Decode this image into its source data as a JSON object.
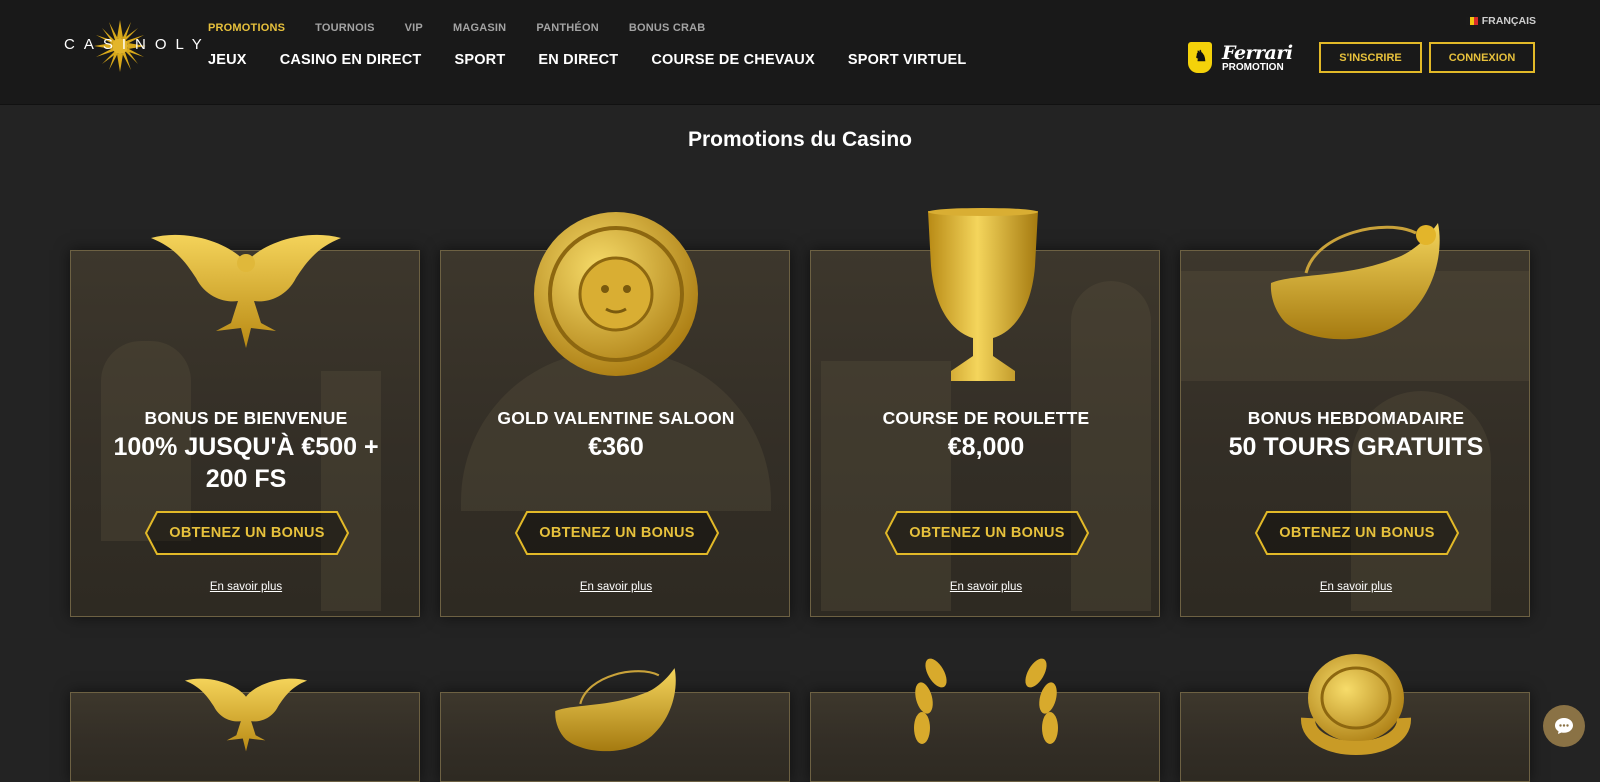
{
  "header": {
    "logo_text": "CASINOLY",
    "top_links": [
      {
        "label": "PROMOTIONS",
        "active": true
      },
      {
        "label": "TOURNOIS",
        "active": false
      },
      {
        "label": "VIP",
        "active": false
      },
      {
        "label": "MAGASIN",
        "active": false
      },
      {
        "label": "PANTHÉON",
        "active": false
      },
      {
        "label": "BONUS CRAB",
        "active": false
      }
    ],
    "main_links": [
      "JEUX",
      "CASINO EN DIRECT",
      "SPORT",
      "EN DIRECT",
      "COURSE DE CHEVAUX",
      "SPORT VIRTUEL"
    ],
    "language": "FRANÇAIS",
    "ferrari_word": "Ferrari",
    "ferrari_promo": "PROMOTION",
    "signup_label": "S'INSCRIRE",
    "login_label": "CONNEXION"
  },
  "page": {
    "title": "Promotions du Casino"
  },
  "promotions": [
    {
      "subtitle": "BONUS DE BIENVENUE",
      "headline": "100% JUSQU'À €500 + 200 FS",
      "button": "OBTENEZ UN BONUS",
      "link": "En savoir plus",
      "art_icon": "gold-eagle-icon"
    },
    {
      "subtitle": "GOLD VALENTINE SALOON",
      "headline": "€360",
      "button": "OBTENEZ UN BONUS",
      "link": "En savoir plus",
      "art_icon": "gold-medusa-shield-icon"
    },
    {
      "subtitle": "COURSE DE ROULETTE",
      "headline": "€8,000",
      "button": "OBTENEZ UN BONUS",
      "link": "En savoir plus",
      "art_icon": "gold-chalice-icon"
    },
    {
      "subtitle": "BONUS HEBDOMADAIRE",
      "headline": "50 TOURS GRATUITS",
      "button": "OBTENEZ UN BONUS",
      "link": "En savoir plus",
      "art_icon": "gold-earring-icon"
    }
  ],
  "promotions_row2": [
    {
      "art_icon": "gold-eagle-icon"
    },
    {
      "art_icon": "gold-earring-icon"
    },
    {
      "art_icon": "gold-laurel-wreath-icon"
    },
    {
      "art_icon": "gold-signet-ring-icon"
    }
  ],
  "colors": {
    "accent": "#e7c13c",
    "header_bg": "#191919",
    "page_bg": "#232323"
  }
}
